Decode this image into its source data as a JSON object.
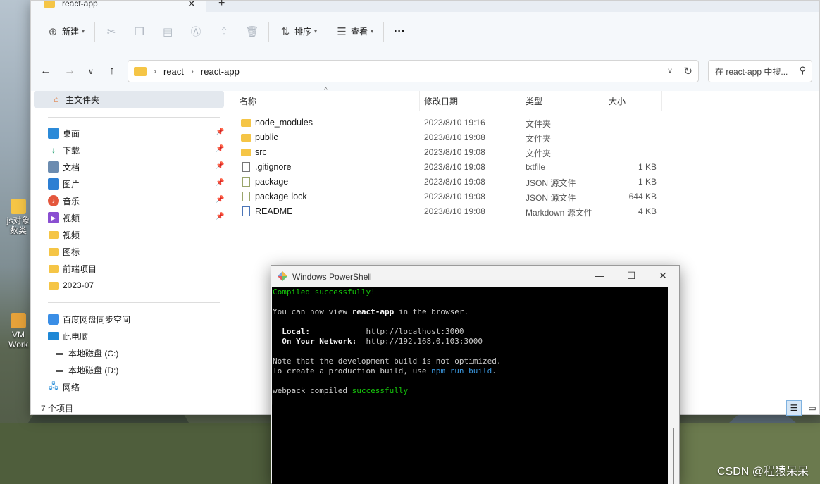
{
  "explorer": {
    "tab_title": "react-app",
    "toolbar": {
      "new_label": "新建",
      "sort_label": "排序",
      "view_label": "查看",
      "more_label": "···"
    },
    "breadcrumb": [
      "react",
      "react-app"
    ],
    "search_placeholder": "在 react-app 中搜...",
    "sidebar": {
      "home_label": "主文件夹",
      "pinned": [
        {
          "label": "桌面",
          "icon": "desktop-icon"
        },
        {
          "label": "下载",
          "icon": "download-icon"
        },
        {
          "label": "文档",
          "icon": "document-icon"
        },
        {
          "label": "图片",
          "icon": "picture-icon"
        },
        {
          "label": "音乐",
          "icon": "music-icon"
        },
        {
          "label": "视频",
          "icon": "video-icon"
        }
      ],
      "folders": [
        "视频",
        "图标",
        "前端项目",
        "2023-07"
      ],
      "devices": [
        {
          "label": "百度网盘同步空间",
          "icon": "baidu-netdisk-icon"
        },
        {
          "label": "此电脑",
          "icon": "this-pc-icon"
        },
        {
          "label": "本地磁盘 (C:)",
          "icon": "drive-icon"
        },
        {
          "label": "本地磁盘 (D:)",
          "icon": "drive-icon"
        },
        {
          "label": "网络",
          "icon": "network-icon"
        }
      ]
    },
    "columns": {
      "name": "名称",
      "date": "修改日期",
      "type": "类型",
      "size": "大小"
    },
    "files": [
      {
        "name": "node_modules",
        "date": "2023/8/10 19:16",
        "type": "文件夹",
        "size": "",
        "icon": "folder-icon"
      },
      {
        "name": "public",
        "date": "2023/8/10 19:08",
        "type": "文件夹",
        "size": "",
        "icon": "folder-icon"
      },
      {
        "name": "src",
        "date": "2023/8/10 19:08",
        "type": "文件夹",
        "size": "",
        "icon": "folder-icon"
      },
      {
        "name": ".gitignore",
        "date": "2023/8/10 19:08",
        "type": "txtfile",
        "size": "1 KB",
        "icon": "text-file-icon"
      },
      {
        "name": "package",
        "date": "2023/8/10 19:08",
        "type": "JSON 源文件",
        "size": "1 KB",
        "icon": "json-file-icon"
      },
      {
        "name": "package-lock",
        "date": "2023/8/10 19:08",
        "type": "JSON 源文件",
        "size": "644 KB",
        "icon": "json-file-icon"
      },
      {
        "name": "README",
        "date": "2023/8/10 19:08",
        "type": "Markdown 源文件",
        "size": "4 KB",
        "icon": "markdown-file-icon"
      }
    ],
    "status": "7 个项目"
  },
  "powershell": {
    "title": "Windows PowerShell",
    "lines": {
      "compiled": "Compiled successfully!",
      "view_pre": "You can now view ",
      "app": "react-app",
      "view_post": " in the browser.",
      "local_label": "  Local:            ",
      "local_url": "http://localhost:3000",
      "network_label": "  On Your Network:  ",
      "network_url": "http://192.168.0.103:3000",
      "note": "Note that the development build is not optimized.",
      "build_pre": "To create a production build, use ",
      "build_cmd": "npm run build",
      "build_post": ".",
      "webpack_pre": "webpack compiled ",
      "webpack_ok": "successfully"
    }
  },
  "desktop": {
    "icons": [
      {
        "label": "js对象数类"
      },
      {
        "label": "VM Work"
      }
    ],
    "watermark": "CSDN @程猿呆呆"
  }
}
